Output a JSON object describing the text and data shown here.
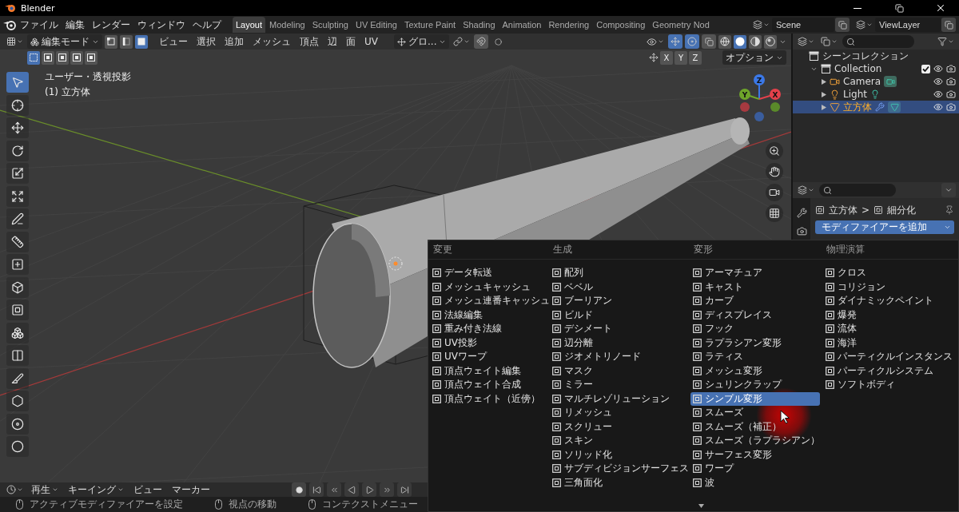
{
  "window": {
    "title": "Blender"
  },
  "menubar": [
    "ファイル",
    "編集",
    "レンダー",
    "ウィンドウ",
    "ヘルプ"
  ],
  "workspaces": [
    {
      "label": "Layout",
      "selected": true
    },
    {
      "label": "Modeling",
      "selected": false
    },
    {
      "label": "Sculpting",
      "selected": false
    },
    {
      "label": "UV Editing",
      "selected": false
    },
    {
      "label": "Texture Paint",
      "selected": false
    },
    {
      "label": "Shading",
      "selected": false
    },
    {
      "label": "Animation",
      "selected": false
    },
    {
      "label": "Rendering",
      "selected": false
    },
    {
      "label": "Compositing",
      "selected": false
    },
    {
      "label": "Geometry Nod",
      "selected": false
    }
  ],
  "scene": "Scene",
  "view_layer": "ViewLayer",
  "viewport": {
    "mode": "編集モード",
    "select_modes": [
      {
        "kind": "vertex",
        "selected": false
      },
      {
        "kind": "edge",
        "selected": false
      },
      {
        "kind": "face",
        "selected": true
      }
    ],
    "menus": [
      "ビュー",
      "選択",
      "追加",
      "メッシュ",
      "頂点",
      "辺",
      "面",
      "UV"
    ],
    "orientation": "グロ...",
    "box_modes": [
      {
        "selected": true
      },
      {
        "selected": false
      },
      {
        "selected": false
      },
      {
        "selected": false
      },
      {
        "selected": false
      }
    ],
    "shading": [
      {
        "kind": "wireframe",
        "selected": false
      },
      {
        "kind": "solid",
        "selected": true
      },
      {
        "kind": "material",
        "selected": false
      },
      {
        "kind": "rendered",
        "selected": false
      }
    ],
    "axes": [
      "X",
      "Y",
      "Z"
    ],
    "options": "オプション",
    "view_name": "ユーザー・透視投影",
    "object_name": "(1) 立方体",
    "gizmo": [
      "Z",
      "Y",
      "X"
    ]
  },
  "tools": [
    {
      "kind": "select",
      "selected": true
    },
    {
      "kind": "cursor",
      "selected": false
    },
    {
      "kind": "move",
      "selected": false
    },
    {
      "kind": "rotate",
      "selected": false
    },
    {
      "kind": "scale",
      "selected": false
    },
    {
      "kind": "transform",
      "selected": false
    },
    {
      "kind": "annotate",
      "selected": false
    },
    {
      "kind": "measure",
      "selected": false
    },
    {
      "kind": "add",
      "selected": false
    },
    {
      "kind": "extrude",
      "selected": false
    },
    {
      "kind": "inset",
      "selected": false
    },
    {
      "kind": "bevel",
      "selected": false
    },
    {
      "kind": "loopcut",
      "selected": false
    },
    {
      "kind": "knife",
      "selected": false
    },
    {
      "kind": "polybuild",
      "selected": false
    },
    {
      "kind": "spin",
      "selected": false
    },
    {
      "kind": "smooth",
      "selected": false
    }
  ],
  "outliner": {
    "root": "シーンコレクション",
    "items": [
      {
        "name": "Collection",
        "kind": "collection",
        "checked": true,
        "selected": false,
        "children": [
          {
            "name": "Camera",
            "kind": "camera",
            "selected": false
          },
          {
            "name": "Light",
            "kind": "light",
            "selected": false
          },
          {
            "name": "立方体",
            "kind": "mesh",
            "selected": true
          }
        ]
      }
    ]
  },
  "properties": {
    "object": "立方体",
    "separator": ">",
    "modifier": "細分化",
    "add_button": "モディファイアーを追加"
  },
  "timeline": {
    "menus": [
      {
        "label": "再生",
        "dropdown": true
      },
      {
        "label": "キーイング",
        "dropdown": true
      },
      {
        "label": "ビュー",
        "dropdown": false
      },
      {
        "label": "マーカー",
        "dropdown": false
      }
    ]
  },
  "status_bar": [
    "アクティブモディファイアーを設定",
    "視点の移動",
    "コンテクストメニュー"
  ],
  "modifier_menu": {
    "columns": [
      {
        "heading": "変更",
        "items": [
          {
            "label": "データ転送",
            "selected": false
          },
          {
            "label": "メッシュキャッシュ",
            "selected": false
          },
          {
            "label": "メッシュ連番キャッシュ",
            "selected": false
          },
          {
            "label": "法線編集",
            "selected": false
          },
          {
            "label": "重み付き法線",
            "selected": false
          },
          {
            "label": "UV投影",
            "selected": false
          },
          {
            "label": "UVワープ",
            "selected": false
          },
          {
            "label": "頂点ウェイト編集",
            "selected": false
          },
          {
            "label": "頂点ウェイト合成",
            "selected": false
          },
          {
            "label": "頂点ウェイト（近傍）",
            "selected": false
          }
        ]
      },
      {
        "heading": "生成",
        "items": [
          {
            "label": "配列",
            "selected": false
          },
          {
            "label": "ベベル",
            "selected": false
          },
          {
            "label": "ブーリアン",
            "selected": false
          },
          {
            "label": "ビルド",
            "selected": false
          },
          {
            "label": "デシメート",
            "selected": false
          },
          {
            "label": "辺分離",
            "selected": false
          },
          {
            "label": "ジオメトリノード",
            "selected": false
          },
          {
            "label": "マスク",
            "selected": false
          },
          {
            "label": "ミラー",
            "selected": false
          },
          {
            "label": "マルチレゾリューション",
            "selected": false
          },
          {
            "label": "リメッシュ",
            "selected": false
          },
          {
            "label": "スクリュー",
            "selected": false
          },
          {
            "label": "スキン",
            "selected": false
          },
          {
            "label": "ソリッド化",
            "selected": false
          },
          {
            "label": "サブディビジョンサーフェス",
            "selected": false
          },
          {
            "label": "三角面化",
            "selected": false
          }
        ]
      },
      {
        "heading": "変形",
        "items": [
          {
            "label": "アーマチュア",
            "selected": false
          },
          {
            "label": "キャスト",
            "selected": false
          },
          {
            "label": "カーブ",
            "selected": false
          },
          {
            "label": "ディスプレイス",
            "selected": false
          },
          {
            "label": "フック",
            "selected": false
          },
          {
            "label": "ラプラシアン変形",
            "selected": false
          },
          {
            "label": "ラティス",
            "selected": false
          },
          {
            "label": "メッシュ変形",
            "selected": false
          },
          {
            "label": "シュリンクラップ",
            "selected": false
          },
          {
            "label": "シンプル変形",
            "selected": true
          },
          {
            "label": "スムーズ",
            "selected": false
          },
          {
            "label": "スムーズ（補正）",
            "selected": false
          },
          {
            "label": "スムーズ（ラプラシアン）",
            "selected": false
          },
          {
            "label": "サーフェス変形",
            "selected": false
          },
          {
            "label": "ワープ",
            "selected": false
          },
          {
            "label": "波",
            "selected": false
          }
        ]
      },
      {
        "heading": "物理演算",
        "items": [
          {
            "label": "クロス",
            "selected": false
          },
          {
            "label": "コリジョン",
            "selected": false
          },
          {
            "label": "ダイナミックペイント",
            "selected": false
          },
          {
            "label": "爆発",
            "selected": false
          },
          {
            "label": "流体",
            "selected": false
          },
          {
            "label": "海洋",
            "selected": false
          },
          {
            "label": "パーティクルインスタンス",
            "selected": false
          },
          {
            "label": "パーティクルシステム",
            "selected": false
          },
          {
            "label": "ソフトボディ",
            "selected": false
          }
        ]
      }
    ]
  }
}
